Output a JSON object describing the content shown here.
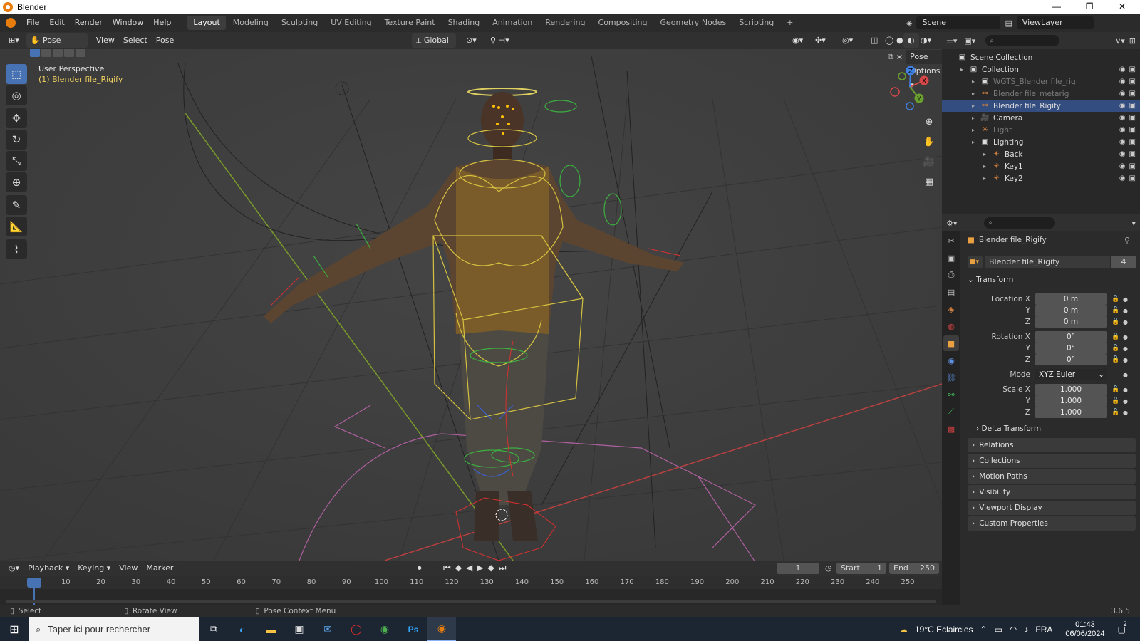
{
  "window": {
    "title": "Blender",
    "min": "—",
    "max": "❐",
    "close": "✕"
  },
  "menu": [
    "File",
    "Edit",
    "Render",
    "Window",
    "Help"
  ],
  "workspaces": [
    "Layout",
    "Modeling",
    "Sculpting",
    "UV Editing",
    "Texture Paint",
    "Shading",
    "Animation",
    "Rendering",
    "Compositing",
    "Geometry Nodes",
    "Scripting",
    "+"
  ],
  "active_workspace": "Layout",
  "scene": {
    "name": "Scene",
    "view_layer": "ViewLayer"
  },
  "vp_header": {
    "mode": "Pose Mode",
    "view": "View",
    "select": "Select",
    "pose": "Pose",
    "orientation": "Global",
    "pose_options": "Pose Options"
  },
  "viewport": {
    "perspective": "User Perspective",
    "object": "(1) Blender file_Rigify"
  },
  "gizmo": {
    "x": "X",
    "y": "Y",
    "z": "Z"
  },
  "outliner": {
    "search_placeholder": "",
    "rows": [
      {
        "label": "Scene Collection",
        "indent": 0,
        "icon": "collection-icon",
        "state": "normal"
      },
      {
        "label": "Collection",
        "indent": 1,
        "icon": "collection-icon",
        "state": "normal"
      },
      {
        "label": "WGTS_Blender file_rig",
        "indent": 2,
        "icon": "collection-icon",
        "state": "dim"
      },
      {
        "label": "Blender file_metarig",
        "indent": 2,
        "icon": "armature-icon",
        "state": "dim"
      },
      {
        "label": "Blender file_Rigify",
        "indent": 2,
        "icon": "armature-icon",
        "state": "sel"
      },
      {
        "label": "Camera",
        "indent": 2,
        "icon": "camera-icon",
        "state": "normal"
      },
      {
        "label": "Light",
        "indent": 2,
        "icon": "light-icon",
        "state": "dim"
      },
      {
        "label": "Lighting",
        "indent": 2,
        "icon": "collection-icon",
        "state": "normal"
      },
      {
        "label": "Back",
        "indent": 3,
        "icon": "light-icon",
        "state": "normal"
      },
      {
        "label": "Key1",
        "indent": 3,
        "icon": "light-icon",
        "state": "normal"
      },
      {
        "label": "Key2",
        "indent": 3,
        "icon": "light-icon",
        "state": "normal"
      }
    ]
  },
  "properties": {
    "object_name": "Blender file_Rigify",
    "datablock": "Blender file_Rigify",
    "users": "4",
    "transform_title": "Transform",
    "location": {
      "label_x": "Location X",
      "x": "0 m",
      "y": "0 m",
      "z": "0 m"
    },
    "rotation": {
      "label_x": "Rotation X",
      "x": "0°",
      "y": "0°",
      "z": "0°"
    },
    "mode": {
      "label": "Mode",
      "value": "XYZ Euler"
    },
    "scale": {
      "label_x": "Scale X",
      "x": "1.000",
      "y": "1.000",
      "z": "1.000"
    },
    "y": "Y",
    "z": "Z",
    "panels": [
      "Delta Transform",
      "Relations",
      "Collections",
      "Motion Paths",
      "Visibility",
      "Viewport Display",
      "Custom Properties"
    ]
  },
  "timeline": {
    "playback": "Playback",
    "keying": "Keying",
    "view": "View",
    "marker": "Marker",
    "current_frame": "1",
    "start_label": "Start",
    "start": "1",
    "end_label": "End",
    "end": "250",
    "ticks": [
      "1",
      "10",
      "20",
      "30",
      "40",
      "50",
      "60",
      "70",
      "80",
      "90",
      "100",
      "110",
      "120",
      "130",
      "140",
      "150",
      "160",
      "170",
      "180",
      "190",
      "200",
      "210",
      "220",
      "230",
      "240",
      "250"
    ]
  },
  "status": {
    "select": "Select",
    "rotate": "Rotate View",
    "context": "Pose Context Menu",
    "version": "3.6.5"
  },
  "taskbar": {
    "search": "Taper ici pour rechercher",
    "weather": "19°C  Eclaircies",
    "lang": "FRA",
    "time": "01:43",
    "date": "06/06/2024",
    "notif": "2"
  }
}
